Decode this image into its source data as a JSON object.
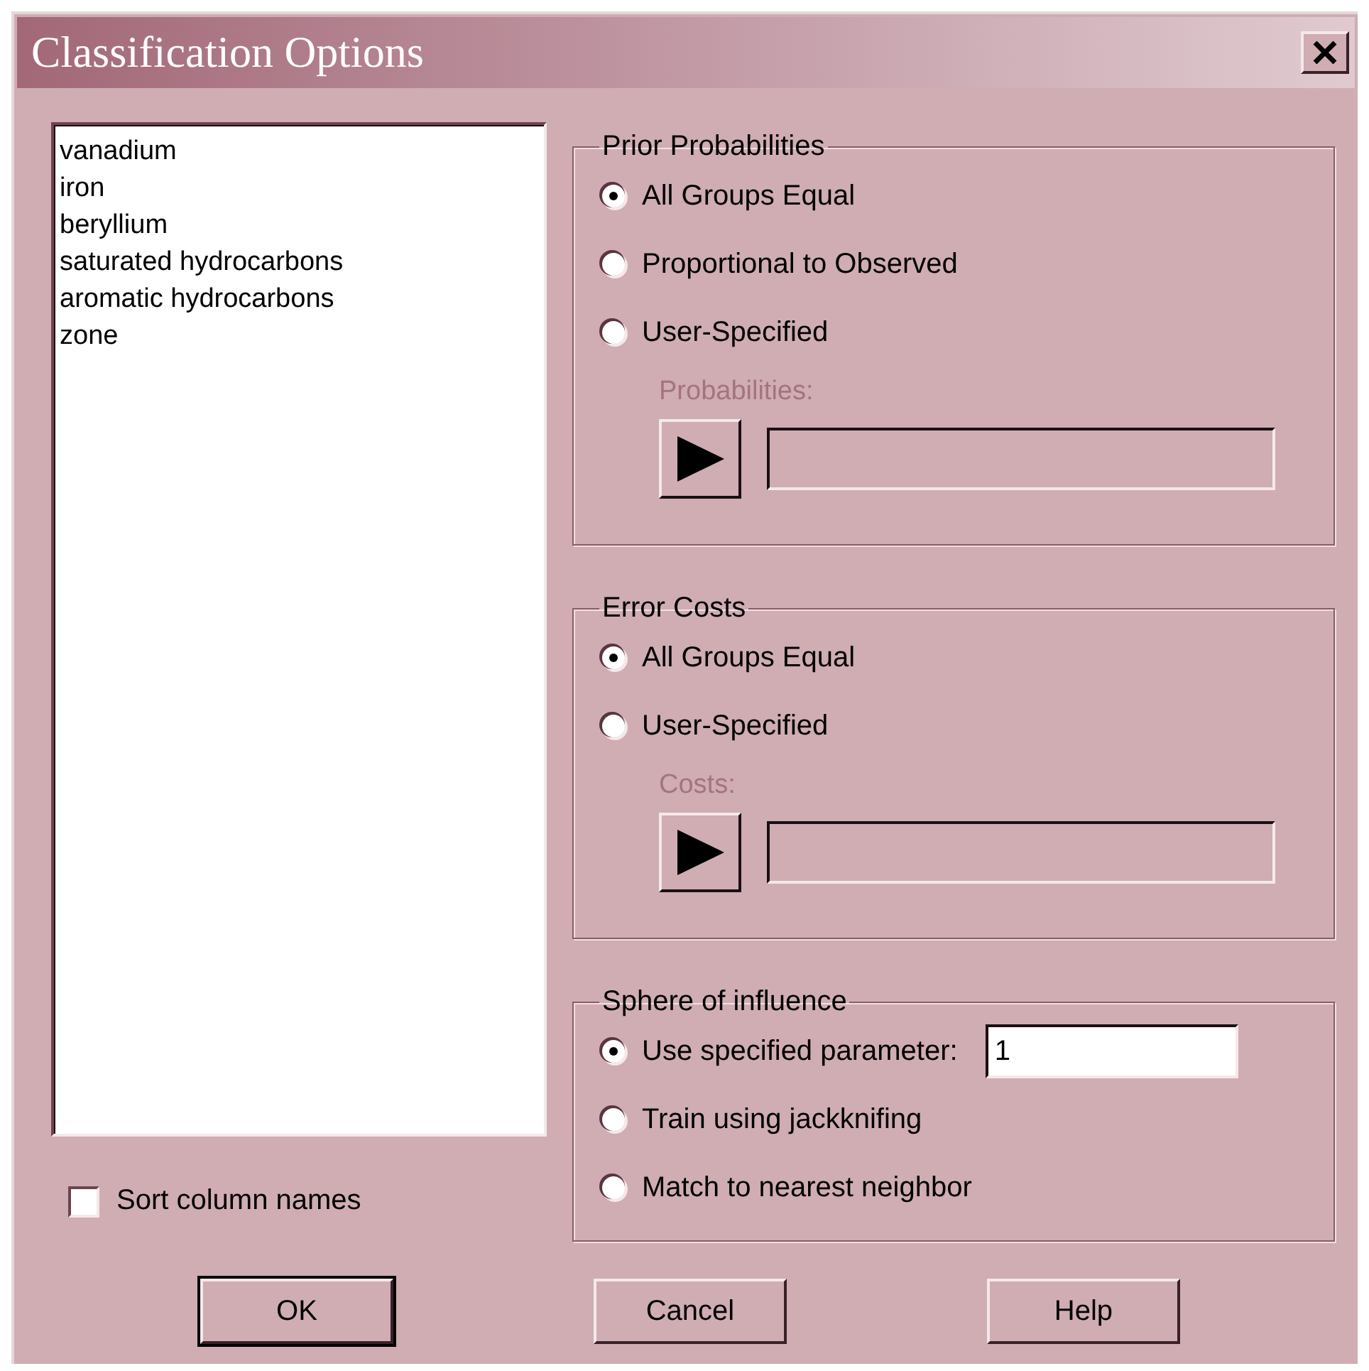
{
  "window": {
    "title": "Classification Options"
  },
  "columns": [
    {
      "name": "vanadium",
      "selected": false
    },
    {
      "name": "iron",
      "selected": false
    },
    {
      "name": "beryllium",
      "selected": false
    },
    {
      "name": "saturated hydrocarbons",
      "selected": false
    },
    {
      "name": "aromatic hydrocarbons",
      "selected": false
    },
    {
      "name": "zone",
      "selected": false
    }
  ],
  "sort_column_names": {
    "label": "Sort column names",
    "checked": false
  },
  "groups": [
    {
      "title": "Prior Probabilities",
      "options": [
        {
          "label": "All Groups Equal",
          "selected": true
        },
        {
          "label": "Proportional to Observed",
          "selected": false
        },
        {
          "label": "User-Specified",
          "selected": false
        }
      ],
      "picker": {
        "label": "Probabilities:",
        "disabled": true
      }
    },
    {
      "title": "Error Costs",
      "options": [
        {
          "label": "All Groups Equal",
          "selected": true
        },
        {
          "label": "User-Specified",
          "selected": false
        }
      ],
      "picker": {
        "label": "Costs:",
        "disabled": true
      }
    },
    {
      "title": "Sphere of influence",
      "options": [
        {
          "label": "Use specified parameter:",
          "selected": true,
          "value": "1"
        },
        {
          "label": "Train using jackknifing",
          "selected": false
        },
        {
          "label": "Match to nearest neighbor",
          "selected": false
        }
      ]
    }
  ],
  "buttons": [
    {
      "label": "OK",
      "default": true
    },
    {
      "label": "Cancel",
      "default": false
    },
    {
      "label": "Help",
      "default": false
    }
  ]
}
